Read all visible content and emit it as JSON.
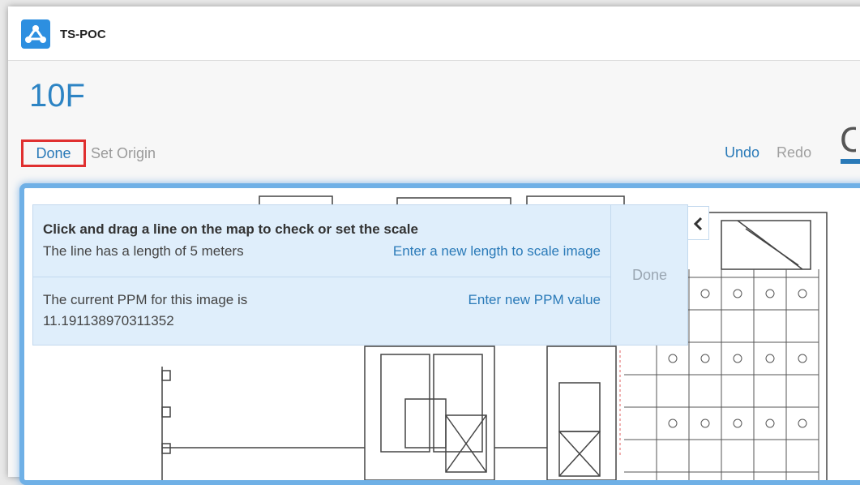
{
  "app": {
    "name": "TS-POC",
    "logo_icon": "network-icon",
    "accent": "#2d8fe0"
  },
  "page": {
    "title": "10F"
  },
  "toolbar": {
    "done_label": "Done",
    "set_origin_label": "Set Origin",
    "undo_label": "Undo",
    "redo_label": "Redo",
    "partial_glyph": "C"
  },
  "scale_panel": {
    "instruction": "Click and drag a line on the map to check or set the scale",
    "line_length_text": "The line has a length of 5 meters",
    "scale_link": "Enter a new length to scale image",
    "ppm_text": "The current PPM for this image is",
    "ppm_value": "11.191138970311352",
    "ppm_link": "Enter new PPM value",
    "done_label": "Done",
    "collapse_icon": "chevron-left-icon"
  },
  "colors": {
    "link": "#2a7ab8",
    "highlight_border": "#e03030",
    "panel_bg": "#dfeefb"
  }
}
